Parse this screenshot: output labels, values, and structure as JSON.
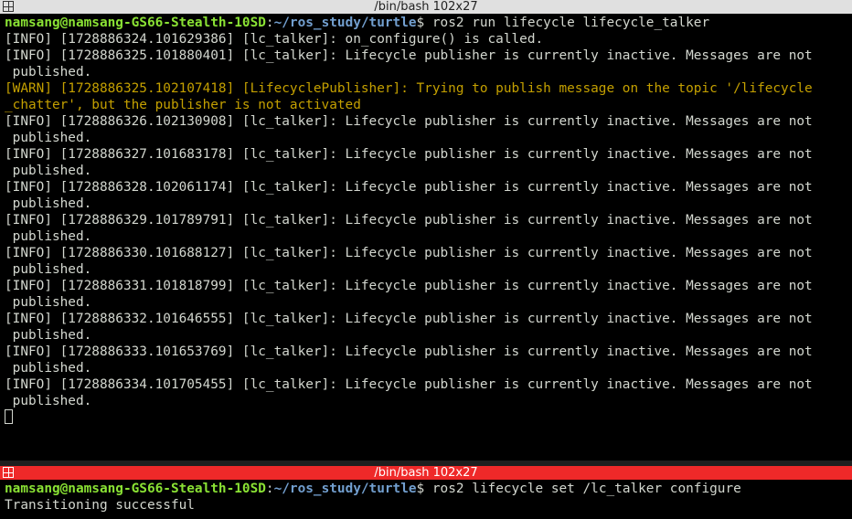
{
  "top_window": {
    "title": "/bin/bash 102x27",
    "prompt": {
      "user_host": "namsang@namsang-GS66-Stealth-10SD",
      "sep": ":",
      "path": "~/ros_study/turtle",
      "dollar": "$",
      "command": " ros2 run lifecycle lifecycle_talker"
    },
    "lines": [
      {
        "text": "[INFO] [1728886324.101629386] [lc_talker]: on_configure() is called.",
        "level": "info"
      },
      {
        "text": "[INFO] [1728886325.101880401] [lc_talker]: Lifecycle publisher is currently inactive. Messages are not",
        "level": "info"
      },
      {
        "text": " published.",
        "level": "info"
      },
      {
        "text": "[WARN] [1728886325.102107418] [LifecyclePublisher]: Trying to publish message on the topic '/lifecycle",
        "level": "warn"
      },
      {
        "text": "_chatter', but the publisher is not activated",
        "level": "warn"
      },
      {
        "text": "[INFO] [1728886326.102130908] [lc_talker]: Lifecycle publisher is currently inactive. Messages are not",
        "level": "info"
      },
      {
        "text": " published.",
        "level": "info"
      },
      {
        "text": "[INFO] [1728886327.101683178] [lc_talker]: Lifecycle publisher is currently inactive. Messages are not",
        "level": "info"
      },
      {
        "text": " published.",
        "level": "info"
      },
      {
        "text": "[INFO] [1728886328.102061174] [lc_talker]: Lifecycle publisher is currently inactive. Messages are not",
        "level": "info"
      },
      {
        "text": " published.",
        "level": "info"
      },
      {
        "text": "[INFO] [1728886329.101789791] [lc_talker]: Lifecycle publisher is currently inactive. Messages are not",
        "level": "info"
      },
      {
        "text": " published.",
        "level": "info"
      },
      {
        "text": "[INFO] [1728886330.101688127] [lc_talker]: Lifecycle publisher is currently inactive. Messages are not",
        "level": "info"
      },
      {
        "text": " published.",
        "level": "info"
      },
      {
        "text": "[INFO] [1728886331.101818799] [lc_talker]: Lifecycle publisher is currently inactive. Messages are not",
        "level": "info"
      },
      {
        "text": " published.",
        "level": "info"
      },
      {
        "text": "[INFO] [1728886332.101646555] [lc_talker]: Lifecycle publisher is currently inactive. Messages are not",
        "level": "info"
      },
      {
        "text": " published.",
        "level": "info"
      },
      {
        "text": "[INFO] [1728886333.101653769] [lc_talker]: Lifecycle publisher is currently inactive. Messages are not",
        "level": "info"
      },
      {
        "text": " published.",
        "level": "info"
      },
      {
        "text": "[INFO] [1728886334.101705455] [lc_talker]: Lifecycle publisher is currently inactive. Messages are not",
        "level": "info"
      },
      {
        "text": " published.",
        "level": "info"
      }
    ]
  },
  "bottom_window": {
    "title": "/bin/bash 102x27",
    "prompt": {
      "user_host": "namsang@namsang-GS66-Stealth-10SD",
      "sep": ":",
      "path": "~/ros_study/turtle",
      "dollar": "$",
      "command": " ros2 lifecycle set /lc_talker configure"
    },
    "output": "Transitioning successful"
  },
  "colors": {
    "background": "#000000",
    "text": "#d3d7cf",
    "user_host": "#8ae234",
    "path": "#729fcf",
    "warn": "#c4a000",
    "active_titlebar": "#ef2929",
    "inactive_titlebar": "#e0e0e0"
  },
  "icons": {
    "titlebar_icon": "split-window-icon"
  }
}
